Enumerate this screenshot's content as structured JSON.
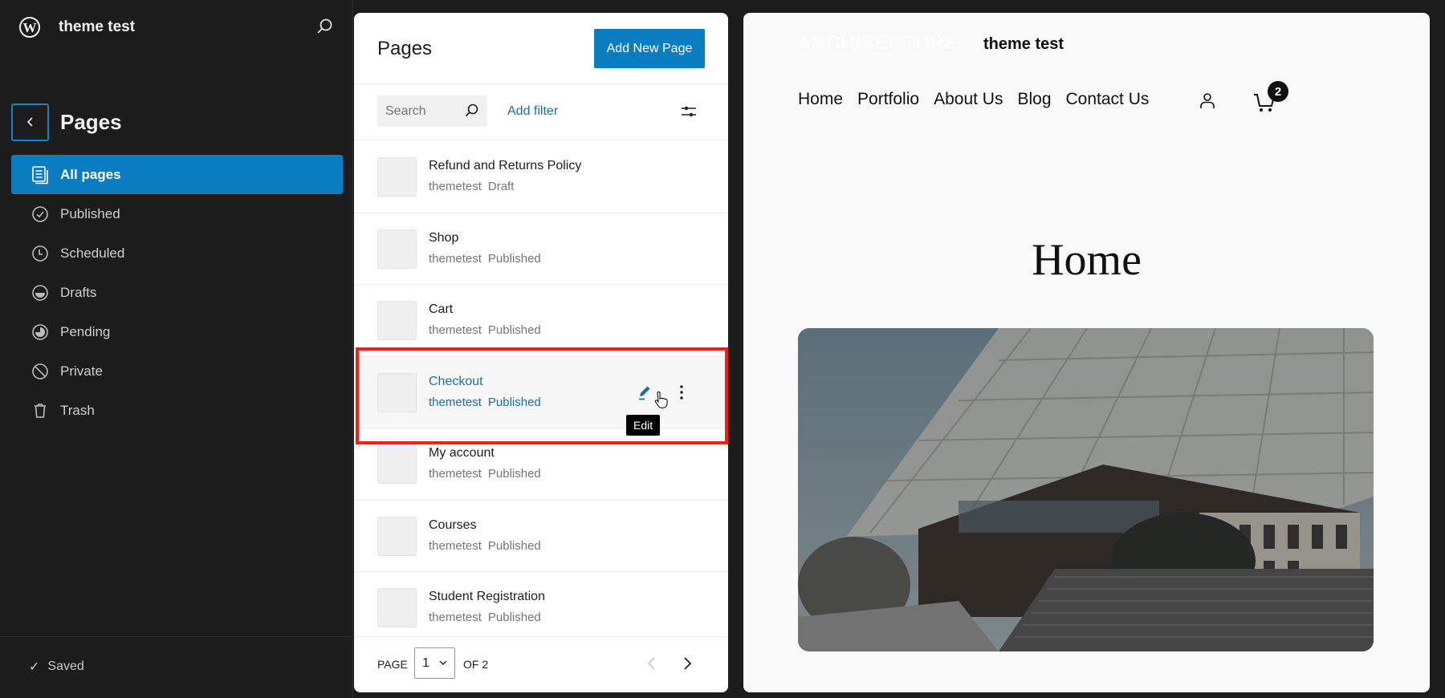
{
  "sidebar": {
    "site_name": "theme test",
    "title": "Pages",
    "items": [
      {
        "label": "All pages",
        "icon": "pages-icon",
        "active": true
      },
      {
        "label": "Published",
        "icon": "published-icon"
      },
      {
        "label": "Scheduled",
        "icon": "scheduled-icon"
      },
      {
        "label": "Drafts",
        "icon": "drafts-icon"
      },
      {
        "label": "Pending",
        "icon": "pending-icon"
      },
      {
        "label": "Private",
        "icon": "private-icon"
      },
      {
        "label": "Trash",
        "icon": "trash-icon"
      }
    ],
    "status": "Saved"
  },
  "panel": {
    "title": "Pages",
    "add_button": "Add New Page",
    "search_placeholder": "Search",
    "add_filter": "Add filter",
    "rows": [
      {
        "title": "Refund and Returns Policy",
        "author": "themetest",
        "status": "Draft"
      },
      {
        "title": "Shop",
        "author": "themetest",
        "status": "Published"
      },
      {
        "title": "Cart",
        "author": "themetest",
        "status": "Published"
      },
      {
        "title": "Checkout",
        "author": "themetest",
        "status": "Published",
        "hovered": true
      },
      {
        "title": "My account",
        "author": "themetest",
        "status": "Published"
      },
      {
        "title": "Courses",
        "author": "themetest",
        "status": "Published"
      },
      {
        "title": "Student Registration",
        "author": "themetest",
        "status": "Published"
      }
    ],
    "tooltip": "Edit",
    "pagination": {
      "page_label": "PAGE",
      "current_page": "1",
      "of_label": "OF 2"
    }
  },
  "preview": {
    "logo": "ARCHITECTURE",
    "site_title": "theme test",
    "nav": [
      "Home",
      "Portfolio",
      "About Us",
      "Blog",
      "Contact Us"
    ],
    "cart_count": "2",
    "page_title": "Home"
  },
  "colors": {
    "accent": "#0a7cc0",
    "highlight": "#f2200e",
    "sidebar_bg": "#1c1c1c"
  }
}
